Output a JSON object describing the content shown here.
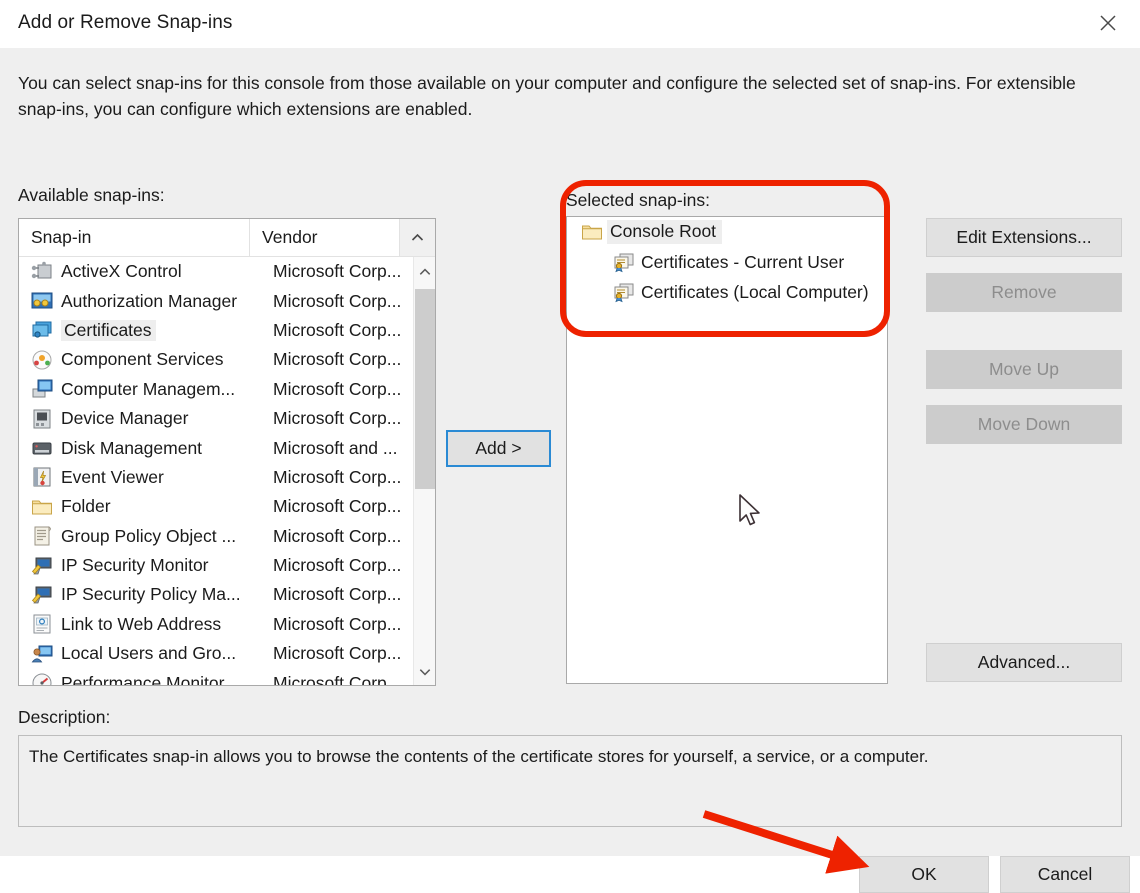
{
  "window": {
    "title": "Add or Remove Snap-ins",
    "close_icon": "close-icon"
  },
  "intro": "You can select snap-ins for this console from those available on your computer and configure the selected set of snap-ins. For extensible snap-ins, you can configure which extensions are enabled.",
  "available": {
    "label": "Available snap-ins:",
    "columns": [
      "Snap-in",
      "Vendor"
    ],
    "sort_icon": "chevron-up-icon",
    "selected_row": "Certificates",
    "rows": [
      {
        "name": "ActiveX Control",
        "vendor": "Microsoft Corp...",
        "icon": "activex-control-icon"
      },
      {
        "name": "Authorization Manager",
        "vendor": "Microsoft Corp...",
        "icon": "authorization-manager-icon"
      },
      {
        "name": "Certificates",
        "vendor": "Microsoft Corp...",
        "icon": "certificates-icon"
      },
      {
        "name": "Component Services",
        "vendor": "Microsoft Corp...",
        "icon": "component-services-icon"
      },
      {
        "name": "Computer Managem...",
        "vendor": "Microsoft Corp...",
        "icon": "computer-management-icon"
      },
      {
        "name": "Device Manager",
        "vendor": "Microsoft Corp...",
        "icon": "device-manager-icon"
      },
      {
        "name": "Disk Management",
        "vendor": "Microsoft and ...",
        "icon": "disk-management-icon"
      },
      {
        "name": "Event Viewer",
        "vendor": "Microsoft Corp...",
        "icon": "event-viewer-icon"
      },
      {
        "name": "Folder",
        "vendor": "Microsoft Corp...",
        "icon": "folder-icon"
      },
      {
        "name": "Group Policy Object ...",
        "vendor": "Microsoft Corp...",
        "icon": "group-policy-object-icon"
      },
      {
        "name": "IP Security Monitor",
        "vendor": "Microsoft Corp...",
        "icon": "ip-security-monitor-icon"
      },
      {
        "name": "IP Security Policy Ma...",
        "vendor": "Microsoft Corp...",
        "icon": "ip-security-policy-icon"
      },
      {
        "name": "Link to Web Address",
        "vendor": "Microsoft Corp...",
        "icon": "link-to-web-address-icon"
      },
      {
        "name": "Local Users and Gro...",
        "vendor": "Microsoft Corp...",
        "icon": "local-users-and-groups-icon"
      },
      {
        "name": "Performance Monitor",
        "vendor": "Microsoft Corp",
        "icon": "performance-monitor-icon"
      }
    ],
    "scroll_up_icon": "chevron-up-icon",
    "scroll_down_icon": "chevron-down-icon"
  },
  "add_button": {
    "label": "Add >"
  },
  "selected": {
    "label": "Selected snap-ins:",
    "selected_row": "Console Root",
    "tree": [
      {
        "label": "Console Root",
        "icon": "folder-icon",
        "level": 0
      },
      {
        "label": "Certificates - Current User",
        "icon": "certificate-snapin-icon",
        "level": 1
      },
      {
        "label": "Certificates (Local Computer)",
        "icon": "certificate-snapin-icon",
        "level": 1
      }
    ]
  },
  "side_buttons": [
    {
      "label": "Edit Extensions...",
      "enabled": true
    },
    {
      "label": "Remove",
      "enabled": false
    },
    {
      "label": "Move Up",
      "enabled": false
    },
    {
      "label": "Move Down",
      "enabled": false
    },
    {
      "label": "Advanced...",
      "enabled": true
    }
  ],
  "description": {
    "label": "Description:",
    "text": "The Certificates snap-in allows you to browse the contents of the certificate stores for yourself, a service, or a computer."
  },
  "footer": {
    "ok_label": "OK",
    "cancel_label": "Cancel"
  },
  "annotations": {
    "highlight_color": "#ee2200",
    "box_target": "selected-snapins-panel",
    "arrow_target": "ok-button"
  }
}
